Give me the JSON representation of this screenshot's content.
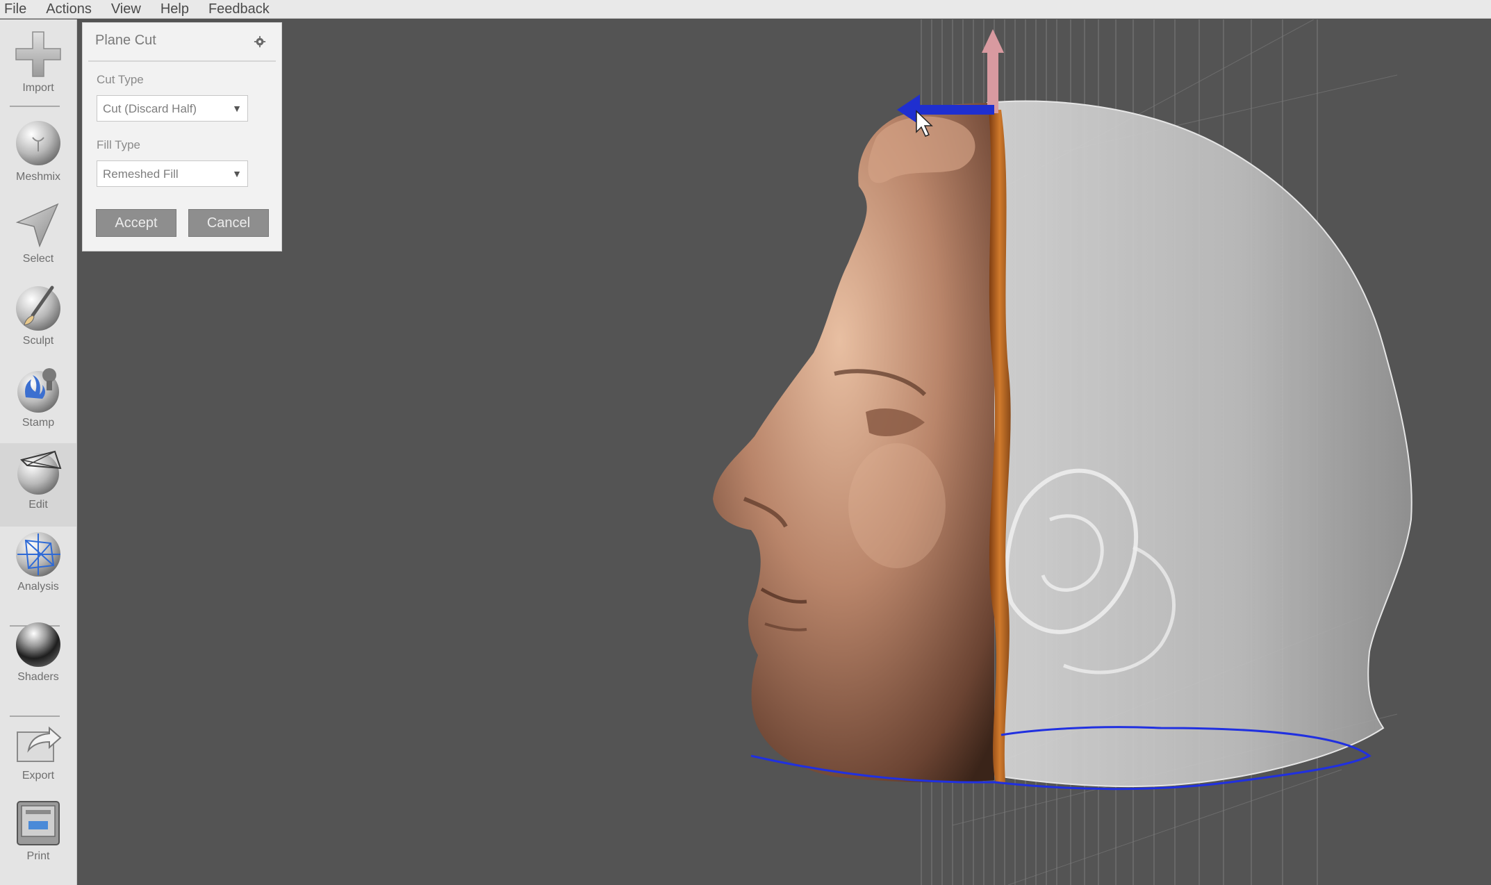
{
  "menu": [
    "File",
    "Actions",
    "View",
    "Help",
    "Feedback"
  ],
  "toolbar": {
    "tools": [
      {
        "label": "Import",
        "icon": "import-plus-icon"
      },
      {
        "label": "Meshmix",
        "icon": "meshmix-sphere-icon"
      },
      {
        "label": "Select",
        "icon": "select-arrow-icon"
      },
      {
        "label": "Sculpt",
        "icon": "sculpt-brush-icon"
      },
      {
        "label": "Stamp",
        "icon": "stamp-icon"
      },
      {
        "label": "Edit",
        "icon": "edit-sphere-icon"
      },
      {
        "label": "Analysis",
        "icon": "analysis-mesh-icon"
      },
      {
        "label": "Shaders",
        "icon": "shaders-sphere-icon"
      },
      {
        "label": "Export",
        "icon": "export-icon"
      },
      {
        "label": "Print",
        "icon": "print-icon"
      }
    ],
    "active": "Edit"
  },
  "panel": {
    "title": "Plane Cut",
    "settings_icon": "gear-icon",
    "cut_type_label": "Cut Type",
    "cut_type_value": "Cut (Discard Half)",
    "fill_type_label": "Fill Type",
    "fill_type_value": "Remeshed Fill",
    "accept_label": "Accept",
    "cancel_label": "Cancel"
  },
  "colors": {
    "viewport_bg": "#545454",
    "mesh_skin": "#b9856a",
    "cut_edge": "#c06a20",
    "ghost_mesh": "#d8d8d8",
    "gizmo_arrow_blue": "#1f2fd0",
    "gizmo_arrow_pink": "#d89aa0",
    "boundary_loop": "#2030e0"
  }
}
